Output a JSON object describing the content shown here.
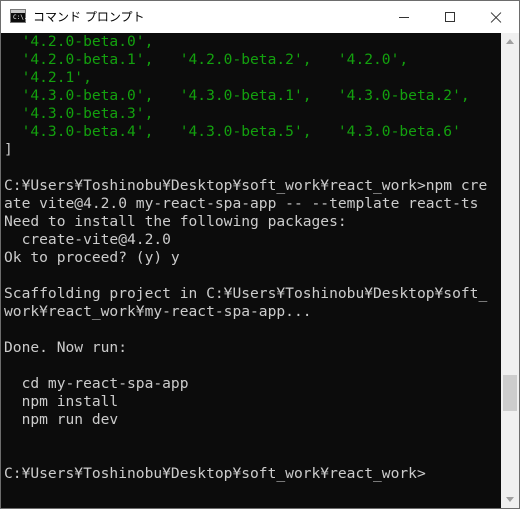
{
  "window": {
    "title": "コマンド プロンプト",
    "icon_text": "C:\\."
  },
  "colors": {
    "console_bg": "#0c0c0c",
    "console_text": "#cccccc",
    "version_text": "#13a10e"
  },
  "console": {
    "lines": [
      {
        "text": "  '4.2.0-beta.0',",
        "color": "green"
      },
      {
        "text": "  '4.2.0-beta.1',   '4.2.0-beta.2',   '4.2.0',",
        "color": "green"
      },
      {
        "text": "  '4.2.1',",
        "color": "green"
      },
      {
        "text": "  '4.3.0-beta.0',   '4.3.0-beta.1',   '4.3.0-beta.2',",
        "color": "green"
      },
      {
        "text": "  '4.3.0-beta.3',",
        "color": "green"
      },
      {
        "text": "  '4.3.0-beta.4',   '4.3.0-beta.5',   '4.3.0-beta.6'",
        "color": "green"
      },
      {
        "text": "]",
        "color": "white"
      },
      {
        "text": "",
        "color": "white"
      },
      {
        "text": "C:¥Users¥Toshinobu¥Desktop¥soft_work¥react_work>npm cre",
        "color": "white"
      },
      {
        "text": "ate vite@4.2.0 my-react-spa-app -- --template react-ts",
        "color": "white"
      },
      {
        "text": "Need to install the following packages:",
        "color": "white"
      },
      {
        "text": "  create-vite@4.2.0",
        "color": "white"
      },
      {
        "text": "Ok to proceed? (y) y",
        "color": "white"
      },
      {
        "text": "",
        "color": "white"
      },
      {
        "text": "Scaffolding project in C:¥Users¥Toshinobu¥Desktop¥soft_",
        "color": "white"
      },
      {
        "text": "work¥react_work¥my-react-spa-app...",
        "color": "white"
      },
      {
        "text": "",
        "color": "white"
      },
      {
        "text": "Done. Now run:",
        "color": "white"
      },
      {
        "text": "",
        "color": "white"
      },
      {
        "text": "  cd my-react-spa-app",
        "color": "white"
      },
      {
        "text": "  npm install",
        "color": "white"
      },
      {
        "text": "  npm run dev",
        "color": "white"
      },
      {
        "text": "",
        "color": "white"
      },
      {
        "text": "",
        "color": "white"
      },
      {
        "text": "C:¥Users¥Toshinobu¥Desktop¥soft_work¥react_work>",
        "color": "white"
      }
    ]
  },
  "icons": {
    "minimize": "minimize-icon",
    "maximize": "maximize-icon",
    "close": "close-icon",
    "scroll_up": "scroll-up-arrow-icon",
    "scroll_down": "scroll-down-arrow-icon"
  }
}
